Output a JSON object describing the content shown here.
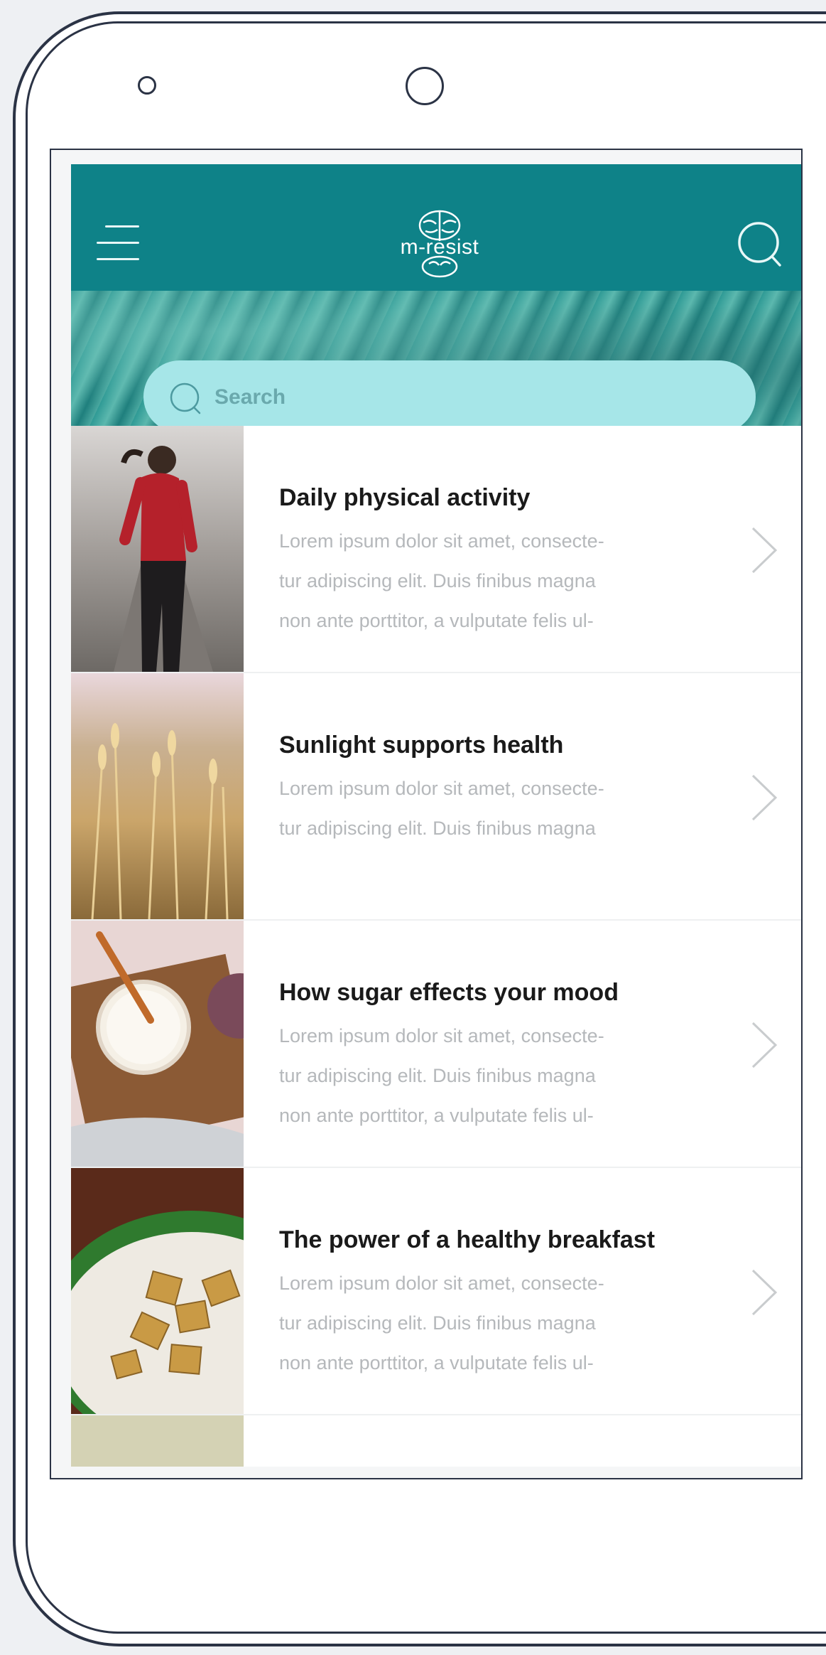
{
  "header": {
    "logo_text": "m-resist"
  },
  "search": {
    "placeholder": "Search"
  },
  "articles": [
    {
      "title": "Daily physical activity",
      "desc_lines": [
        "Lorem ipsum dolor sit amet, consecte-",
        "tur adipiscing elit. Duis finibus magna",
        "non ante porttitor, a vulputate felis ul-"
      ]
    },
    {
      "title": "Sunlight supports health",
      "desc_lines": [
        "Lorem ipsum dolor sit amet, consecte-",
        "tur adipiscing elit. Duis finibus magna"
      ]
    },
    {
      "title": "How sugar effects your mood",
      "desc_lines": [
        "Lorem ipsum dolor sit amet, consecte-",
        "tur adipiscing elit. Duis finibus magna",
        "non ante porttitor, a vulputate felis ul-"
      ]
    },
    {
      "title": "The power of a healthy breakfast",
      "desc_lines": [
        "Lorem ipsum dolor sit amet, consecte-",
        "tur adipiscing elit. Duis finibus magna",
        "non ante porttitor, a vulputate felis ul-"
      ]
    }
  ],
  "colors": {
    "header": "#0e8288",
    "search_bar": "#a6e6e8",
    "title_text": "#1a1a1a",
    "desc_text": "#b5b8bb"
  }
}
